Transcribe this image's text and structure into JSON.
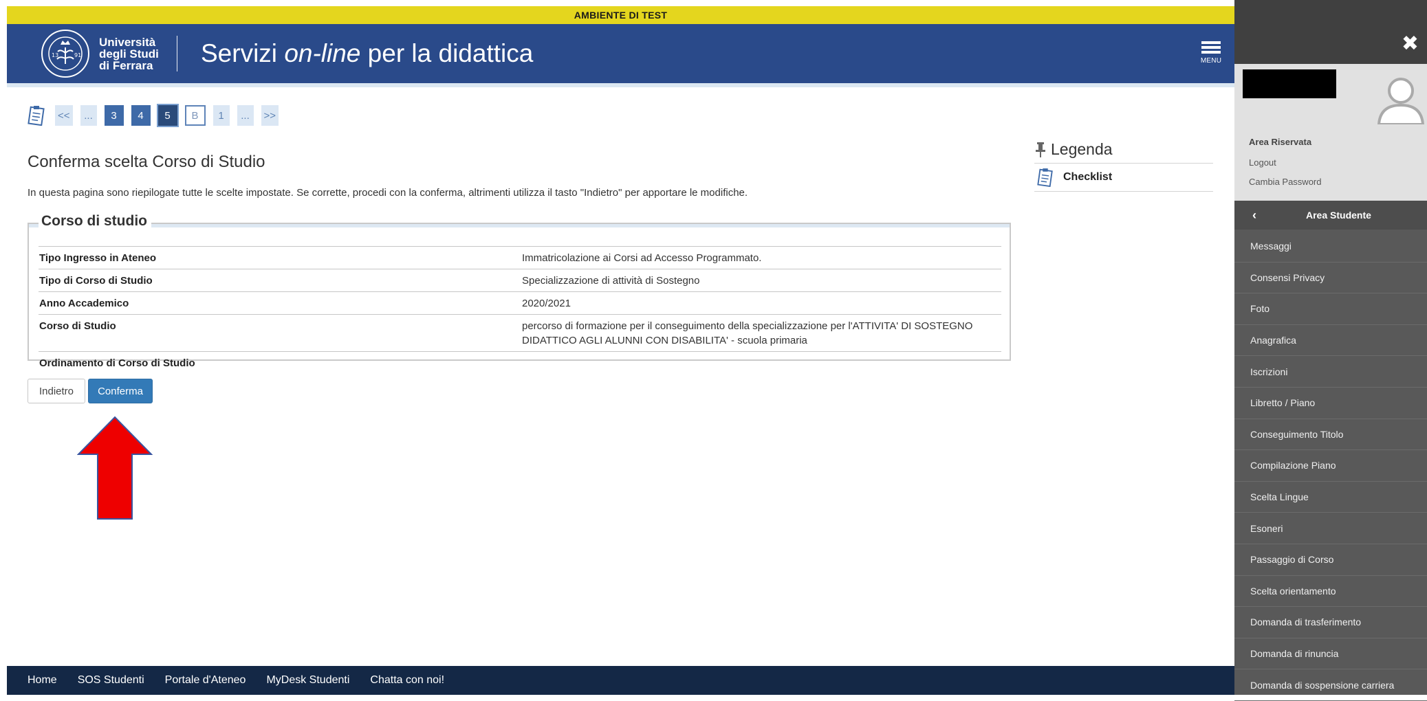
{
  "banner": {
    "text": "AMBIENTE DI TEST"
  },
  "header": {
    "logo_lines": [
      "Università",
      "degli Studi",
      "di Ferrara"
    ],
    "title_prefix": "Servizi ",
    "title_emphasis": "on-line",
    "title_suffix": " per la didattica",
    "menu_label": "MENU"
  },
  "steps": [
    "<<",
    "...",
    "3",
    "4",
    "5",
    "B",
    "1",
    "...",
    ">>"
  ],
  "page": {
    "title": "Conferma scelta Corso di Studio",
    "intro": "In questa pagina sono riepilogate tutte le scelte impostate. Se corrette, procedi con la conferma, altrimenti utilizza il tasto \"Indietro\" per apportare le modifiche.",
    "section_title": "Corso di studio",
    "rows": [
      {
        "label": "Tipo Ingresso in Ateneo",
        "value": "Immatricolazione ai Corsi ad Accesso Programmato."
      },
      {
        "label": "Tipo di Corso di Studio",
        "value": "Specializzazione di attività di Sostegno"
      },
      {
        "label": "Anno Accademico",
        "value": "2020/2021"
      },
      {
        "label": "Corso di Studio",
        "value": "percorso di formazione per il conseguimento della specializzazione per l'ATTIVITA' DI SOSTEGNO DIDATTICO AGLI ALUNNI CON DISABILITA' - scuola primaria"
      },
      {
        "label": "Ordinamento di Corso di Studio",
        "value": ""
      }
    ],
    "back_label": "Indietro",
    "confirm_label": "Conferma"
  },
  "legend": {
    "title": "Legenda",
    "items": [
      "Checklist"
    ]
  },
  "footer": {
    "links": [
      "Home",
      "SOS Studenti",
      "Portale d'Ateneo",
      "MyDesk Studenti",
      "Chatta con noi!"
    ]
  },
  "sidebar": {
    "close": "✖",
    "area_title": "Area Riservata",
    "logout": "Logout",
    "change_password": "Cambia Password",
    "section_title": "Area Studente",
    "items": [
      "Messaggi",
      "Consensi Privacy",
      "Foto",
      "Anagrafica",
      "Iscrizioni",
      "Libretto / Piano",
      "Conseguimento Titolo",
      "Compilazione Piano",
      "Scelta Lingue",
      "Esoneri",
      "Passaggio di Corso",
      "Scelta orientamento",
      "Domanda di trasferimento",
      "Domanda di rinuncia",
      "Domanda di sospensione carriera"
    ]
  },
  "colors": {
    "header": "#2a4a8a",
    "banner": "#e4d61e",
    "primary_button": "#337ab7",
    "footer": "#142846",
    "sidebar": "#595959",
    "annotation_arrow": "#ee0000"
  }
}
